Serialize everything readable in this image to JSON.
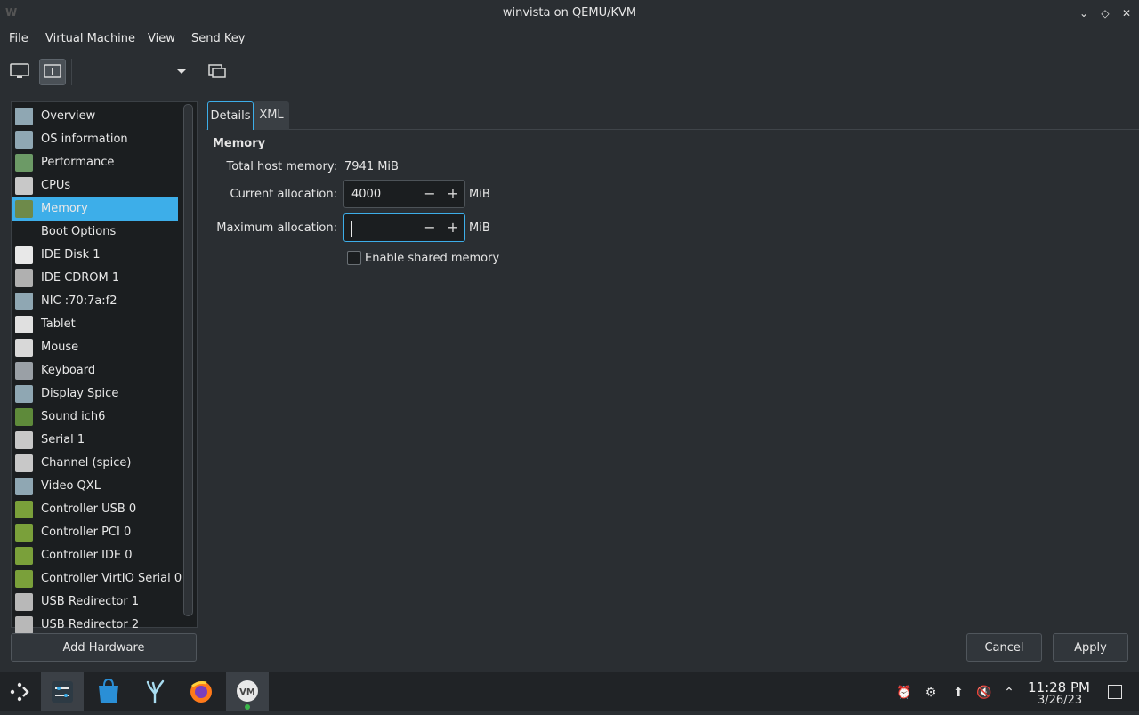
{
  "window": {
    "title": "winvista on QEMU/KVM"
  },
  "menubar": {
    "items": [
      "File",
      "Virtual Machine",
      "View",
      "Send Key"
    ]
  },
  "sidebar": {
    "items": [
      {
        "label": "Overview",
        "icon": "overview-icon",
        "color": "#8fa7b3"
      },
      {
        "label": "OS information",
        "icon": "os-info-icon",
        "color": "#8fa7b3"
      },
      {
        "label": "Performance",
        "icon": "performance-icon",
        "color": "#6c9a66"
      },
      {
        "label": "CPUs",
        "icon": "cpu-icon",
        "color": "#c8c8c8"
      },
      {
        "label": "Memory",
        "icon": "memory-icon",
        "color": "#6e8a4a"
      },
      {
        "label": "Boot Options",
        "icon": "boot-icon",
        "color": "#1b1e20"
      },
      {
        "label": "IDE Disk 1",
        "icon": "disk-icon",
        "color": "#e8e8e8"
      },
      {
        "label": "IDE CDROM 1",
        "icon": "cdrom-icon",
        "color": "#b0b0b0"
      },
      {
        "label": "NIC :70:7a:f2",
        "icon": "nic-icon",
        "color": "#8fa7b3"
      },
      {
        "label": "Tablet",
        "icon": "tablet-icon",
        "color": "#e0e0e0"
      },
      {
        "label": "Mouse",
        "icon": "mouse-icon",
        "color": "#d8d8d8"
      },
      {
        "label": "Keyboard",
        "icon": "keyboard-icon",
        "color": "#9aa0a6"
      },
      {
        "label": "Display Spice",
        "icon": "display-icon",
        "color": "#8fa7b3"
      },
      {
        "label": "Sound ich6",
        "icon": "sound-icon",
        "color": "#5e8a3a"
      },
      {
        "label": "Serial 1",
        "icon": "serial-icon",
        "color": "#c8c8c8"
      },
      {
        "label": "Channel (spice)",
        "icon": "channel-icon",
        "color": "#c8c8c8"
      },
      {
        "label": "Video QXL",
        "icon": "video-icon",
        "color": "#8fa7b3"
      },
      {
        "label": "Controller USB 0",
        "icon": "controller-icon",
        "color": "#7aa03a"
      },
      {
        "label": "Controller PCI 0",
        "icon": "controller-icon",
        "color": "#7aa03a"
      },
      {
        "label": "Controller IDE 0",
        "icon": "controller-icon",
        "color": "#7aa03a"
      },
      {
        "label": "Controller VirtIO Serial 0",
        "icon": "controller-icon",
        "color": "#7aa03a"
      },
      {
        "label": "USB Redirector 1",
        "icon": "usb-icon",
        "color": "#b8b8b8"
      },
      {
        "label": "USB Redirector 2",
        "icon": "usb-icon",
        "color": "#b8b8b8"
      }
    ],
    "selected_index": 4,
    "add_hardware_label": "Add Hardware"
  },
  "tabs": [
    "Details",
    "XML"
  ],
  "memory": {
    "heading": "Memory",
    "total_host_label": "Total host memory:",
    "total_host_value": "7941 MiB",
    "current_label": "Current allocation:",
    "current_value": "4000",
    "current_unit": "MiB",
    "max_label": "Maximum allocation:",
    "max_value": "",
    "max_unit": "MiB",
    "shared_label": "Enable shared memory",
    "shared_checked": false
  },
  "buttons": {
    "cancel": "Cancel",
    "apply": "Apply"
  },
  "taskbar": {
    "time": "11:28 PM",
    "date": "3/26/23"
  },
  "colors": {
    "accent": "#3daee9",
    "background": "#2a2e32",
    "panel": "#1b1e20"
  }
}
